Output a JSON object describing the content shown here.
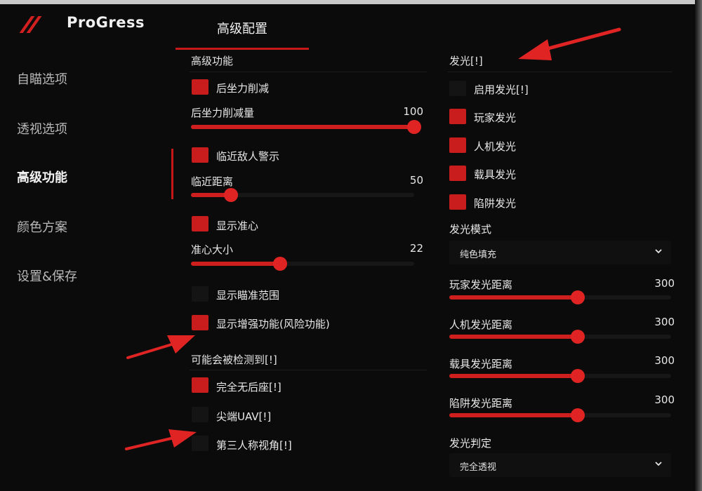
{
  "app": {
    "title": "ProGress"
  },
  "sidebar": {
    "items": [
      {
        "label": "自瞄选项"
      },
      {
        "label": "透视选项"
      },
      {
        "label": "高级功能"
      },
      {
        "label": "颜色方案"
      },
      {
        "label": "设置&保存"
      }
    ],
    "active_index": 2
  },
  "tab": {
    "label": "高级配置"
  },
  "advanced": {
    "header": "高级功能",
    "recoil_reduce": {
      "label": "后坐力削减",
      "checked": true
    },
    "recoil_amount": {
      "label": "后坐力削减量",
      "value": "100",
      "fraction": 1.0
    },
    "proximity_warning": {
      "label": "临近敌人警示",
      "checked": true
    },
    "proximity_distance": {
      "label": "临近距离",
      "value": "50",
      "fraction": 0.18
    },
    "show_crosshair": {
      "label": "显示准心",
      "checked": true
    },
    "crosshair_size": {
      "label": "准心大小",
      "value": "22",
      "fraction": 0.4
    },
    "show_aim_range": {
      "label": "显示瞄准范围",
      "checked": false
    },
    "show_enhanced": {
      "label": "显示增强功能(风险功能)",
      "checked": true
    },
    "risk_header": "可能会被检测到[!]",
    "no_recoil": {
      "label": "完全无后座[!]",
      "checked": true
    },
    "sharp_uav": {
      "label": "尖端UAV[!]",
      "checked": false
    },
    "third_person": {
      "label": "第三人称视角[!]",
      "checked": false
    }
  },
  "glow": {
    "header": "发光[!]",
    "enable": {
      "label": "启用发光[!]",
      "checked": false
    },
    "player": {
      "label": "玩家发光",
      "checked": true
    },
    "bot": {
      "label": "人机发光",
      "checked": true
    },
    "vehicle": {
      "label": "载具发光",
      "checked": true
    },
    "trap": {
      "label": "陷阱发光",
      "checked": true
    },
    "mode_label": "发光模式",
    "mode_value": "纯色填充",
    "player_distance": {
      "label": "玩家发光距离",
      "value": "300",
      "fraction": 0.58
    },
    "bot_distance": {
      "label": "人机发光距离",
      "value": "300",
      "fraction": 0.58
    },
    "vehicle_distance": {
      "label": "载具发光距离",
      "value": "300",
      "fraction": 0.58
    },
    "trap_distance": {
      "label": "陷阱发光距离",
      "value": "300",
      "fraction": 0.58
    },
    "judge_label": "发光判定",
    "judge_value": "完全透视"
  },
  "colors": {
    "accent": "#c91d1d",
    "background": "#0b0b0c",
    "text": "#e8e8e8"
  },
  "icons": {
    "logo": "slash-logo-icon",
    "dropdown": "chevron-down-icon"
  }
}
